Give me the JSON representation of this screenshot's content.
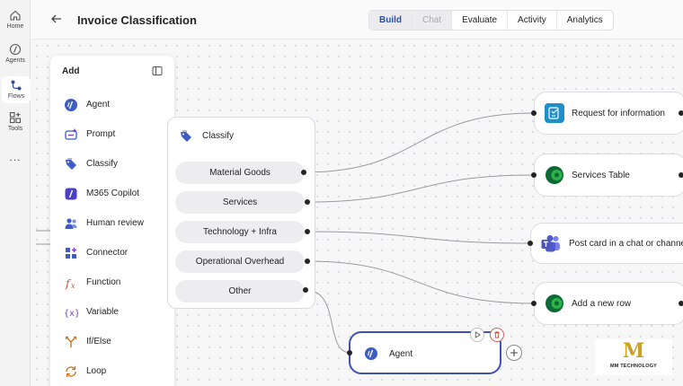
{
  "rail": {
    "items": [
      {
        "label": "Home",
        "icon": "home-icon"
      },
      {
        "label": "Agents",
        "icon": "agents-icon"
      },
      {
        "label": "Flows",
        "icon": "flows-icon"
      },
      {
        "label": "Tools",
        "icon": "tools-icon"
      }
    ],
    "active": "Flows",
    "more": "..."
  },
  "header": {
    "title": "Invoice Classification",
    "tabs": [
      {
        "label": "Build",
        "state": "selected"
      },
      {
        "label": "Chat",
        "state": "disabled"
      },
      {
        "label": "Evaluate",
        "state": "normal"
      },
      {
        "label": "Activity",
        "state": "normal"
      },
      {
        "label": "Analytics",
        "state": "normal"
      }
    ]
  },
  "add_panel": {
    "title": "Add",
    "items": [
      {
        "label": "Agent",
        "icon": "agent-icon"
      },
      {
        "label": "Prompt",
        "icon": "prompt-icon"
      },
      {
        "label": "Classify",
        "icon": "classify-tag-icon"
      },
      {
        "label": "M365 Copilot",
        "icon": "copilot-icon"
      },
      {
        "label": "Human review",
        "icon": "human-review-icon"
      },
      {
        "label": "Connector",
        "icon": "connector-icon"
      },
      {
        "label": "Function",
        "icon": "function-icon"
      },
      {
        "label": "Variable",
        "icon": "variable-icon"
      },
      {
        "label": "If/Else",
        "icon": "if-else-icon"
      },
      {
        "label": "Loop",
        "icon": "loop-icon"
      }
    ]
  },
  "classify_node": {
    "title": "Classify",
    "categories": [
      "Material Goods",
      "Services",
      "Technology + Infra",
      "Operational Overhead",
      "Other"
    ]
  },
  "action_nodes": [
    {
      "label": "Request for information",
      "icon": "form-icon"
    },
    {
      "label": "Services Table",
      "icon": "dataverse-icon"
    },
    {
      "label": "Post card in a chat or channel",
      "icon": "teams-icon"
    },
    {
      "label": "Add a new row",
      "icon": "dataverse-icon"
    }
  ],
  "agent_node": {
    "label": "Agent"
  },
  "watermark": {
    "mark": "M",
    "text": "MM TECHNOLOGY"
  },
  "colors": {
    "accent": "#3f51b5",
    "selected_tab": "#2b4da8",
    "logo_gold": "#c9a227"
  }
}
